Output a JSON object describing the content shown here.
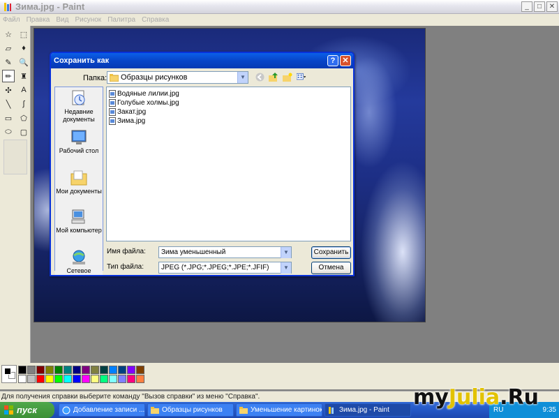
{
  "window": {
    "title": "Зима.jpg - Paint",
    "buttons": [
      "_",
      "□",
      "✕"
    ]
  },
  "menu": [
    "Файл",
    "Правка",
    "Вид",
    "Рисунок",
    "Палитра",
    "Справка"
  ],
  "tools": [
    {
      "name": "free-select-tool",
      "glyph": "☆"
    },
    {
      "name": "rect-select-tool",
      "glyph": "⬚"
    },
    {
      "name": "eraser-tool",
      "glyph": "▱"
    },
    {
      "name": "fill-tool",
      "glyph": "♦"
    },
    {
      "name": "color-picker-tool",
      "glyph": "✎"
    },
    {
      "name": "magnifier-tool",
      "glyph": "🔍"
    },
    {
      "name": "pencil-tool",
      "glyph": "✏"
    },
    {
      "name": "brush-tool",
      "glyph": "♜"
    },
    {
      "name": "airbrush-tool",
      "glyph": "✣"
    },
    {
      "name": "text-tool",
      "glyph": "A"
    },
    {
      "name": "line-tool",
      "glyph": "╲"
    },
    {
      "name": "curve-tool",
      "glyph": "∫"
    },
    {
      "name": "rectangle-tool",
      "glyph": "▭"
    },
    {
      "name": "polygon-tool",
      "glyph": "⬠"
    },
    {
      "name": "ellipse-tool",
      "glyph": "⬭"
    },
    {
      "name": "rounded-rect-tool",
      "glyph": "▢"
    }
  ],
  "palette": {
    "top": [
      "#000000",
      "#808080",
      "#800000",
      "#808000",
      "#008000",
      "#008080",
      "#000080",
      "#800080",
      "#808040",
      "#004040",
      "#0080ff",
      "#004080",
      "#8000ff",
      "#804000"
    ],
    "bottom": [
      "#ffffff",
      "#c0c0c0",
      "#ff0000",
      "#ffff00",
      "#00ff00",
      "#00ffff",
      "#0000ff",
      "#ff00ff",
      "#ffff80",
      "#00ff80",
      "#80ffff",
      "#8080ff",
      "#ff0080",
      "#ff8040"
    ]
  },
  "status": "Для получения справки выберите команду \"Вызов справки\" из меню \"Справка\".",
  "taskbar": {
    "start": "пуск",
    "tasks": [
      "Добавление записи ...",
      "Образцы рисунков",
      "Уменьшение картинок",
      "Зима.jpg - Paint"
    ],
    "lang": "RU",
    "time": "9:35"
  },
  "watermark": {
    "part1": "my",
    "part2": "Julia",
    "part3": ".Ru"
  },
  "dialog": {
    "title": "Сохранить как",
    "help": "?",
    "close": "✕",
    "lookin_label": "Папка:",
    "lookin_value": "Образцы рисунков",
    "places": [
      "Недавние документы",
      "Рабочий стол",
      "Мои документы",
      "Мой компьютер",
      "Сетевое"
    ],
    "files": [
      "Водяные лилии.jpg",
      "Голубые холмы.jpg",
      "Закат.jpg",
      "Зима.jpg"
    ],
    "filename_label": "Имя файла:",
    "filename_value": "Зима уменьшенный",
    "filetype_label": "Тип файла:",
    "filetype_value": "JPEG (*.JPG;*.JPEG;*.JPE;*.JFIF)",
    "save_label": "Сохранить",
    "cancel_label": "Отмена"
  }
}
